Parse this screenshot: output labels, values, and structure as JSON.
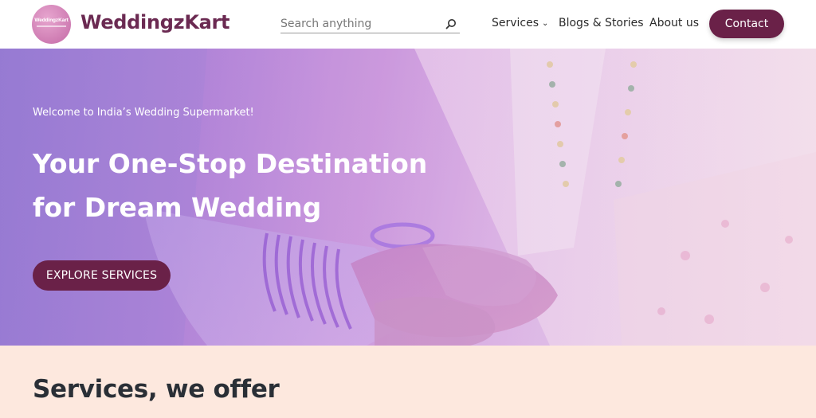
{
  "header": {
    "logo_text": "WeddingzKart",
    "brand": "WeddingzKart",
    "search": {
      "placeholder": "Search anything",
      "value": ""
    },
    "nav": [
      {
        "label": "Services",
        "has_dropdown": true
      },
      {
        "label": "Blogs & Stories"
      },
      {
        "label": "About us"
      }
    ],
    "contact_label": "Contact"
  },
  "hero": {
    "welcome": "Welcome to India’s Wedding Supermarket!",
    "title_line1": "Your One-Stop Destination",
    "title_line2": "for Dream Wedding",
    "cta_label": "EXPLORE SERVICES"
  },
  "services": {
    "heading": "Services, we offer"
  },
  "colors": {
    "brand": "#6a2148",
    "brand_text": "#6b2a52",
    "section_bg": "#fde8de",
    "heading_text": "#2a2f36"
  },
  "icons": {
    "search": "search-icon",
    "services_dropdown": "chevron-down-icon"
  }
}
